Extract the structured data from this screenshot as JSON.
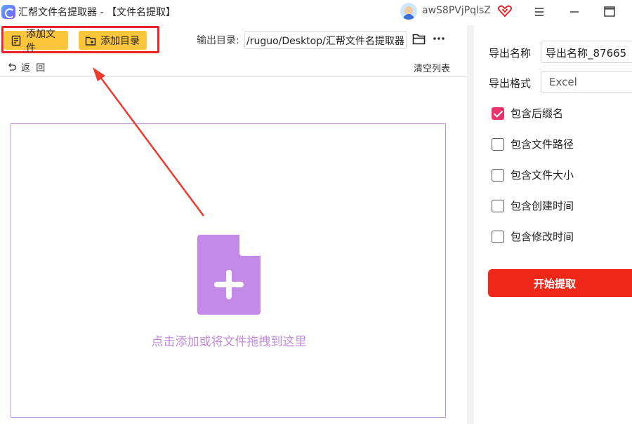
{
  "window": {
    "title": "汇帮文件名提取器 - 【文件名提取】",
    "username": "awS8PVjPqlsZ"
  },
  "toolbar": {
    "add_file_label": "添加文件",
    "add_dir_label": "添加目录",
    "output_dir_label": "输出目录:",
    "output_dir_value": "/ruguo/Desktop/汇帮文件名提取器",
    "undo_label": "返  回",
    "clear_list_label": "清空列表"
  },
  "drop_zone": {
    "text": "点击添加或将文件拖拽到这里"
  },
  "settings": {
    "export_name_label": "导出名称",
    "export_name_value": "导出名称_87665",
    "export_format_label": "导出格式",
    "export_format_value": "Excel",
    "options": [
      {
        "label": "包含后缀名",
        "checked": true
      },
      {
        "label": "包含文件路径",
        "checked": false
      },
      {
        "label": "包含文件大小",
        "checked": false
      },
      {
        "label": "包含创建时间",
        "checked": false
      },
      {
        "label": "包含修改时间",
        "checked": false
      }
    ],
    "start_button_label": "开始提取"
  },
  "colors": {
    "accent_yellow": "#fdc63a",
    "highlight_red": "#e8242a",
    "drop_border": "#c493dc",
    "doc_icon": "#c28ae6",
    "checkbox_checked": "#e8336b",
    "start_button": "#f0281a"
  },
  "icons": {
    "app_logo": "app-logo-icon",
    "vip": "heart-diamond-icon",
    "menu": "hamburger-icon",
    "minimize": "minimize-icon",
    "maximize": "maximize-icon",
    "add_file": "file-list-icon",
    "add_dir": "folder-plus-icon",
    "browse": "folder-open-icon",
    "more": "ellipsis-icon",
    "undo": "undo-icon",
    "drop": "file-plus-icon"
  }
}
